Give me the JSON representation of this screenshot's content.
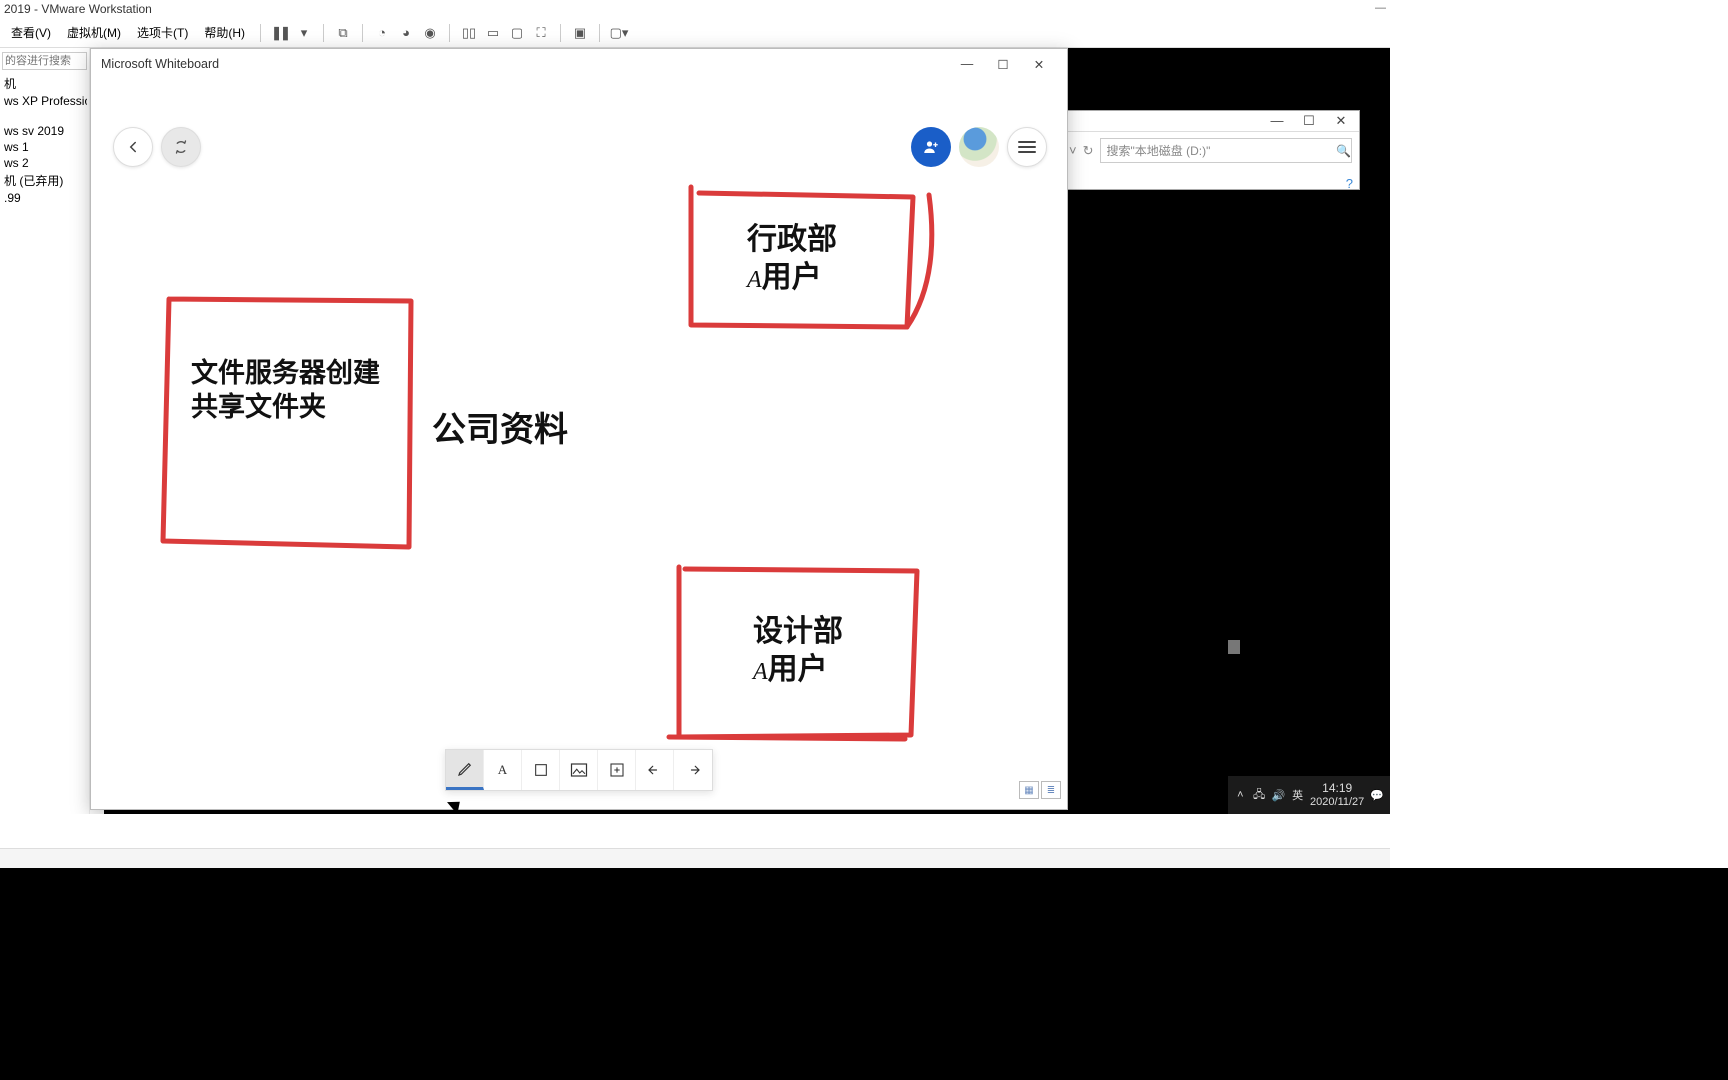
{
  "vmware": {
    "title_suffix": " 2019 - VMware Workstation",
    "menu": {
      "view": "查看(V)",
      "vm": "虚拟机(M)",
      "tabs": "选项卡(T)",
      "help": "帮助(H)"
    }
  },
  "sidebar": {
    "search_placeholder": "的容进行搜索",
    "items": [
      "机",
      "ws XP Professional",
      "ws sv 2019",
      "ws 1",
      "ws 2",
      "机 (已弃用)",
      ".99"
    ]
  },
  "explorer": {
    "search_placeholder": "搜索\"本地磁盘 (D:)\""
  },
  "whiteboard": {
    "title": "Microsoft Whiteboard",
    "box1_line1": "文件服务器创建",
    "box1_line2": "共享文件夹",
    "center_label": "公司资料",
    "box2_line1": "行政部",
    "box2_line2": "A用户",
    "box3_line1": "设计部",
    "box3_line2": "A用户"
  },
  "taskbar": {
    "ime": "英",
    "time": "14:19",
    "date": "2020/11/27"
  }
}
